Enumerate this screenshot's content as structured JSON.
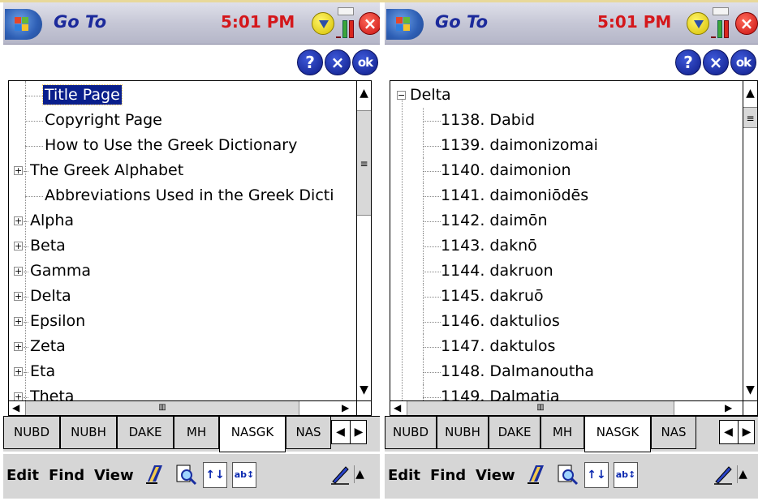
{
  "titlebar": {
    "app_title": "Go To",
    "time": "5:01 PM"
  },
  "commands": {
    "help": "?",
    "cancel": "×",
    "ok": "ok"
  },
  "left_tree": {
    "items": [
      {
        "label": "Title Page",
        "selected": true,
        "expandable": false
      },
      {
        "label": "Copyright Page",
        "selected": false,
        "expandable": false
      },
      {
        "label": "How to Use the Greek Dictionary",
        "selected": false,
        "expandable": false
      },
      {
        "label": "The Greek Alphabet",
        "selected": false,
        "expandable": true
      },
      {
        "label": "Abbreviations Used in the Greek Dicti",
        "selected": false,
        "expandable": false
      },
      {
        "label": "Alpha",
        "selected": false,
        "expandable": true
      },
      {
        "label": "Beta",
        "selected": false,
        "expandable": true
      },
      {
        "label": "Gamma",
        "selected": false,
        "expandable": true
      },
      {
        "label": "Delta",
        "selected": false,
        "expandable": true
      },
      {
        "label": "Epsilon",
        "selected": false,
        "expandable": true
      },
      {
        "label": "Zeta",
        "selected": false,
        "expandable": true
      },
      {
        "label": "Eta",
        "selected": false,
        "expandable": true
      },
      {
        "label": "Theta",
        "selected": false,
        "expandable": true
      }
    ]
  },
  "right_tree": {
    "parent": {
      "label": "Delta",
      "expanded": true
    },
    "items": [
      "1138. Dabid",
      "1139. daimonizomai",
      "1140. daimonion",
      "1141. daimoniōdēs",
      "1142. daimōn",
      "1143. daknō",
      "1144. dakruon",
      "1145. dakruō",
      "1146. daktulios",
      "1147. daktulos",
      "1148. Dalmanoutha",
      "1149. Dalmatia"
    ]
  },
  "tabs": {
    "labels": [
      "NUBD",
      "NUBH",
      "DAKE",
      "MH",
      "NASGK",
      "NAS"
    ],
    "active": "NASGK",
    "prev": "◀",
    "next": "▶"
  },
  "menu": {
    "edit": "Edit",
    "find": "Find",
    "view": "View",
    "sort_icon": "↑↓",
    "sort_alpha_icon": "ab↕"
  },
  "icons": {
    "start": "windows-flag-icon",
    "notify": "notification-icon",
    "signal": "signal-icon",
    "close": "close-icon",
    "book": "book-icon",
    "search": "search-icon",
    "pen": "pen-icon"
  },
  "colors": {
    "title_text": "#1c2a9b",
    "time_text": "#d4171b",
    "selection": "#0a1f8c",
    "round_button": "#0e1c88"
  }
}
